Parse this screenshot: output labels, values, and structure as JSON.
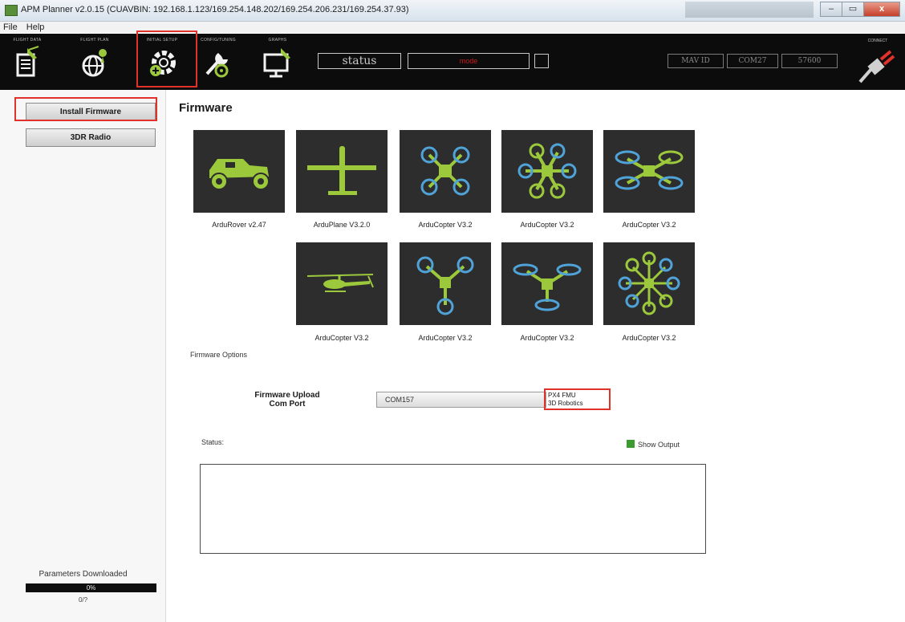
{
  "window": {
    "title": "APM Planner v2.0.15 (CUAVBIN: 192.168.1.123/169.254.148.202/169.254.206.231/169.254.37.93)",
    "minimize_glyph": "–",
    "maximize_glyph": "▭",
    "close_glyph": "x"
  },
  "menu": {
    "items": [
      "File",
      "Help"
    ]
  },
  "toolbar": {
    "buttons": [
      {
        "label": "FLIGHT DATA",
        "icon": "flight-data-icon"
      },
      {
        "label": "FLIGHT PLAN",
        "icon": "flight-plan-icon"
      },
      {
        "label": "INITIAL SETUP",
        "icon": "initial-setup-icon",
        "selected": true
      },
      {
        "label": "CONFIG/TUNING",
        "icon": "config-tuning-icon"
      },
      {
        "label": "GRAPHS",
        "icon": "graphs-icon"
      }
    ],
    "status_text": "status",
    "mode_text": "mode",
    "mav_id": "MAV ID",
    "com_port": "COM27",
    "baud_rate": "57600",
    "connect_label": "CONNECT"
  },
  "sidebar": {
    "items": [
      {
        "label": "Install Firmware",
        "selected": true
      },
      {
        "label": "3DR Radio",
        "selected": false
      }
    ],
    "params_label": "Parameters Downloaded",
    "progress_text": "0%",
    "progress_value": 0,
    "params_count": "0/?"
  },
  "main": {
    "title": "Firmware",
    "firmware_row1": [
      {
        "caption": "ArduRover v2.47",
        "icon": "rover-icon"
      },
      {
        "caption": "ArduPlane V3.2.0",
        "icon": "plane-icon"
      },
      {
        "caption": "ArduCopter V3.2",
        "icon": "quad-x-icon"
      },
      {
        "caption": "ArduCopter V3.2",
        "icon": "hexa-icon"
      },
      {
        "caption": "ArduCopter V3.2",
        "icon": "quad-plus-icon"
      }
    ],
    "firmware_row2": [
      {
        "caption": "ArduCopter V3.2",
        "icon": "heli-icon"
      },
      {
        "caption": "ArduCopter V3.2",
        "icon": "tri-icon"
      },
      {
        "caption": "ArduCopter V3.2",
        "icon": "y6-icon"
      },
      {
        "caption": "ArduCopter V3.2",
        "icon": "octa-icon"
      }
    ],
    "options_label": "Firmware Options",
    "upload_label_line1": "Firmware Upload",
    "upload_label_line2": "Com Port",
    "com_port_value": "COM157",
    "board_line1": "PX4 FMU",
    "board_line2": "3D Robotics",
    "status_label": "Status:",
    "show_output_label": "Show Output",
    "show_output_checked": true,
    "output_text": ""
  },
  "colors": {
    "toolbar_bg": "#0c0c0c",
    "tile_bg": "#2d2d2d",
    "icon_green": "#9cc83c",
    "icon_blue": "#4fa3d8",
    "highlight_red": "#e0312b",
    "checkbox_green": "#3c9b2f"
  }
}
